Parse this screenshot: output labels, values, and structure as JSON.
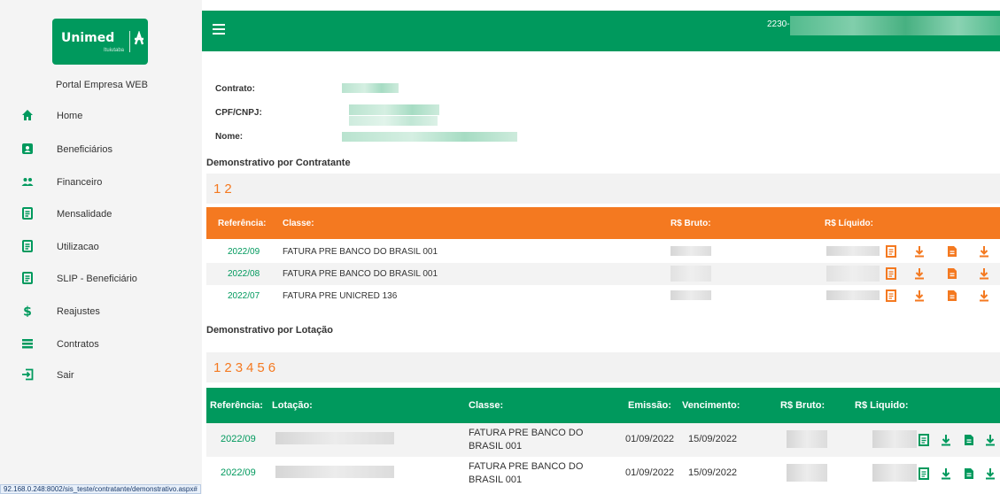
{
  "brand": {
    "logo_text": "Unimed",
    "logo_sub": "Ituiutaba",
    "portal_name": "Portal Empresa WEB"
  },
  "sidebar": {
    "items": [
      {
        "label": "Home",
        "icon": "home-icon"
      },
      {
        "label": "Beneficiários",
        "icon": "person-card-icon"
      },
      {
        "label": "Financeiro",
        "icon": "group-icon"
      },
      {
        "label": "Mensalidade",
        "icon": "document-list-icon"
      },
      {
        "label": "Utilizacao",
        "icon": "document-list-icon"
      },
      {
        "label": "SLIP - Beneficiário",
        "icon": "document-list-icon"
      },
      {
        "label": "Reajustes",
        "icon": "dollar-icon"
      },
      {
        "label": "Contratos",
        "icon": "list-icon"
      },
      {
        "label": "Sair",
        "icon": "exit-icon"
      }
    ]
  },
  "topbar": {
    "user_code": "2230-"
  },
  "info": {
    "contrato_label": "Contrato:",
    "cpf_label": "CPF/CNPJ:",
    "nome_label": "Nome:"
  },
  "section1": {
    "title": "Demonstrativo por Contratante",
    "pages": [
      "1",
      "2"
    ],
    "headers": {
      "referencia": "Referência:",
      "classe": "Classe:",
      "bruto": "R$ Bruto:",
      "liquido": "R$ Líquido:"
    },
    "rows": [
      {
        "ref": "2022/09",
        "classe": "FATURA PRE BANCO DO BRASIL 001"
      },
      {
        "ref": "2022/08",
        "classe": "FATURA PRE BANCO DO BRASIL 001"
      },
      {
        "ref": "2022/07",
        "classe": "FATURA PRE UNICRED 136"
      }
    ]
  },
  "section2": {
    "title": "Demonstrativo por Lotação",
    "pages": [
      "1",
      "2",
      "3",
      "4",
      "5",
      "6"
    ],
    "headers": {
      "referencia": "Referência:",
      "lotacao": "Lotação:",
      "classe": "Classe:",
      "emissao": "Emissão:",
      "vencimento": "Vencimento:",
      "bruto": "R$ Bruto:",
      "liquido": "R$ Liquido:"
    },
    "rows": [
      {
        "ref": "2022/09",
        "classe": "FATURA PRE BANCO DO BRASIL 001",
        "emissao": "01/09/2022",
        "vencimento": "15/09/2022"
      },
      {
        "ref": "2022/09",
        "classe": "FATURA PRE BANCO DO BRASIL 001",
        "emissao": "01/09/2022",
        "vencimento": "15/09/2022"
      }
    ]
  },
  "status_bar": {
    "url": "92.168.0.248:8002/sis_teste/contratante/demonstrativo.aspx#"
  },
  "colors": {
    "green": "#00995d",
    "orange": "#f47920"
  }
}
